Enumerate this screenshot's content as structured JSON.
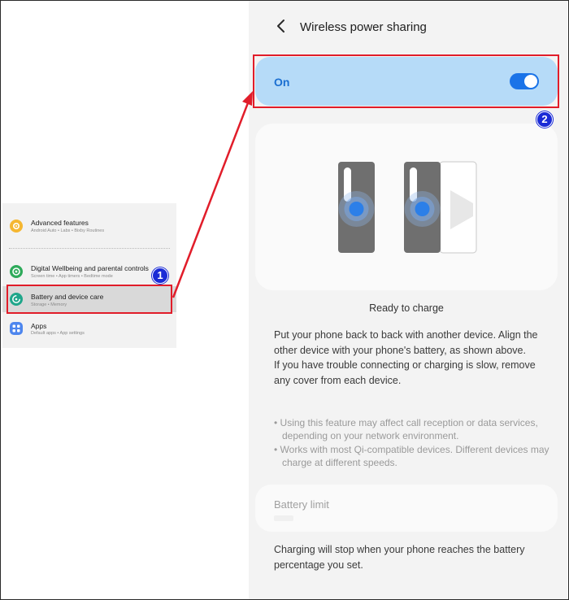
{
  "settings_list": {
    "items": [
      {
        "title": "Advanced features",
        "subtitle": "Android Auto • Labs • Bixby Routines",
        "icon": "advanced-features-icon",
        "color": "#f5b731"
      },
      {
        "title": "Digital Wellbeing and parental controls",
        "subtitle": "Screen time • App timers • Bedtime mode",
        "icon": "digital-wellbeing-icon",
        "color": "#2eaa5a"
      },
      {
        "title": "Battery and device care",
        "subtitle": "Storage • Memory",
        "icon": "battery-care-icon",
        "color": "#1fa68a"
      },
      {
        "title": "Apps",
        "subtitle": "Default apps • App settings",
        "icon": "apps-icon",
        "color": "#4d86ee"
      }
    ]
  },
  "annotations": {
    "step1": "1",
    "step2": "2",
    "highlight_color": "#e11d2a",
    "badge_color": "#1a2bd6"
  },
  "wireless_sharing": {
    "title": "Wireless power sharing",
    "toggle_label": "On",
    "toggle_state": true,
    "status": "Ready to charge",
    "description_lines": [
      "Put your phone back to back with another device. Align the other device with your phone's battery, as shown above.",
      "If you have trouble connecting or charging is slow, remove any cover from each device."
    ],
    "notes": [
      "• Using this feature may affect call reception or data services, depending on your network environment.",
      "• Works with most Qi-compatible devices. Different devices may charge at different speeds."
    ],
    "battery_limit": {
      "title": "Battery limit",
      "note": "Charging will stop when your phone reaches the battery percentage you set."
    },
    "accent_color": "#1a73e8"
  }
}
